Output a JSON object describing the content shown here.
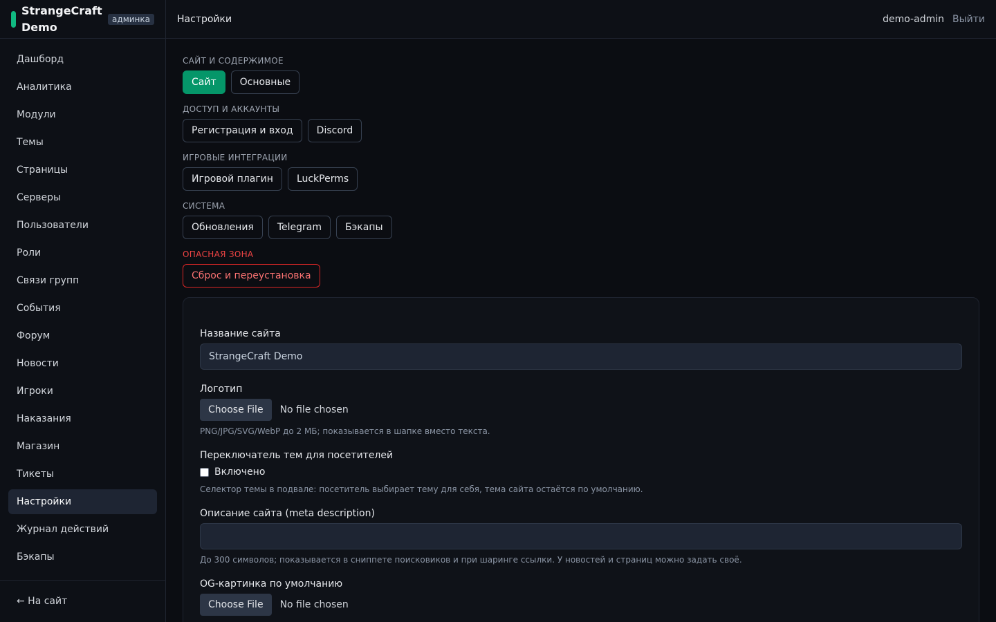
{
  "brand": {
    "name": "StrangeCraft Demo",
    "badge": "админка"
  },
  "sidebar": {
    "items": [
      {
        "label": "Дашборд"
      },
      {
        "label": "Аналитика"
      },
      {
        "label": "Модули"
      },
      {
        "label": "Темы"
      },
      {
        "label": "Страницы"
      },
      {
        "label": "Серверы"
      },
      {
        "label": "Пользователи"
      },
      {
        "label": "Роли"
      },
      {
        "label": "Связи групп"
      },
      {
        "label": "События"
      },
      {
        "label": "Форум"
      },
      {
        "label": "Новости"
      },
      {
        "label": "Игроки"
      },
      {
        "label": "Наказания"
      },
      {
        "label": "Магазин"
      },
      {
        "label": "Тикеты"
      },
      {
        "label": "Настройки",
        "active": true
      },
      {
        "label": "Журнал действий"
      },
      {
        "label": "Бэкапы"
      }
    ],
    "back_link": "← На сайт"
  },
  "header": {
    "title": "Настройки",
    "user": "demo-admin",
    "logout": "Выйти"
  },
  "groups": [
    {
      "label": "Сайт и содержимое",
      "buttons": [
        {
          "label": "Сайт",
          "active": true
        },
        {
          "label": "Основные"
        }
      ]
    },
    {
      "label": "Доступ и аккаунты",
      "buttons": [
        {
          "label": "Регистрация и вход"
        },
        {
          "label": "Discord"
        }
      ]
    },
    {
      "label": "Игровые интеграции",
      "buttons": [
        {
          "label": "Игровой плагин"
        },
        {
          "label": "LuckPerms"
        }
      ]
    },
    {
      "label": "Система",
      "buttons": [
        {
          "label": "Обновления"
        },
        {
          "label": "Telegram"
        },
        {
          "label": "Бэкапы"
        }
      ]
    },
    {
      "label": "Опасная зона",
      "danger": true,
      "buttons": [
        {
          "label": "Сброс и переустановка"
        }
      ]
    }
  ],
  "form": {
    "site_name": {
      "label": "Название сайта",
      "value": "StrangeCraft Demo"
    },
    "logo": {
      "label": "Логотип",
      "button": "Choose File",
      "status": "No file chosen",
      "hint": "PNG/JPG/SVG/WebP до 2 МБ; показывается в шапке вместо текста."
    },
    "theme_switcher": {
      "label": "Переключатель тем для посетителей",
      "checkbox_label": "Включено",
      "checked": false,
      "hint": "Селектор темы в подвале: посетитель выбирает тему для себя, тема сайта остаётся по умолчанию."
    },
    "meta_description": {
      "label": "Описание сайта (meta description)",
      "value": "",
      "hint": "До 300 символов; показывается в сниппете поисковиков и при шаринге ссылки. У новостей и страниц можно задать своё."
    },
    "og_image": {
      "label": "OG-картинка по умолчанию",
      "button": "Choose File",
      "status": "No file chosen"
    }
  },
  "colors": {
    "accent": "#059669",
    "danger": "#ef4444",
    "background": "#0b0d12"
  }
}
